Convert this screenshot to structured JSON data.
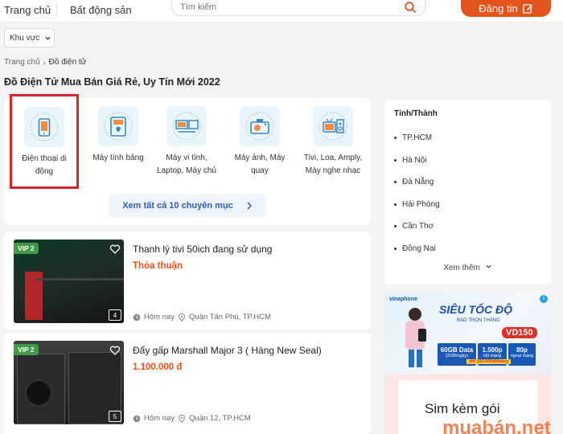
{
  "header": {
    "nav": [
      "Trang chủ",
      "Bất động sản"
    ],
    "search_placeholder": "Tìm kiếm",
    "post_button": "Đăng tin"
  },
  "filter": {
    "region_label": "Khu vực"
  },
  "breadcrumb": [
    "Trang chủ",
    "Đồ điện tử"
  ],
  "page_title": "Đồ Điện Tử Mua Bán Giá Rẻ, Uy Tín Mới 2022",
  "categories": [
    {
      "line1": "Điện thoại di",
      "line2": "động",
      "icon": "phone-icon"
    },
    {
      "line1": "Máy tính bảng",
      "line2": "",
      "icon": "tablet-icon"
    },
    {
      "line1": "Máy vi tính,",
      "line2": "Laptop, Máy chủ",
      "icon": "computer-icon"
    },
    {
      "line1": "Máy ảnh, Máy",
      "line2": "quay",
      "icon": "camera-icon"
    },
    {
      "line1": "Tivi, Loa, Amply,",
      "line2": "Máy nghe nhạc",
      "icon": "tv-icon"
    }
  ],
  "see_all_label": "Xem tất cả 10 chuyên mục",
  "listings": [
    {
      "badge": "VIP 2",
      "title": "Thanh lý tivi 50ich đang sử dụng",
      "price": "Thỏa thuận",
      "time": "Hôm nay",
      "location": "Quận Tân Phú, TP.HCM",
      "image_count": "4"
    },
    {
      "badge": "VIP 2",
      "title": "Đẩy gấp Marshall Major 3 ( Hàng New Seal)",
      "price": "1.100.000 đ",
      "time": "Hôm nay",
      "location": "Quận 12, TP.HCM",
      "image_count": "5"
    }
  ],
  "sidebar": {
    "title": "Tỉnh/Thành",
    "provinces": [
      "TP.HCM",
      "Hà Nội",
      "Đà Nẵng",
      "Hải Phòng",
      "Cần Thơ",
      "Đồng Nai"
    ],
    "see_more": "Xem thêm"
  },
  "ad": {
    "brand": "vinaphone",
    "headline": "SIÊU TỐC ĐỘ",
    "subhead": "BAO TRỌN THÁNG",
    "package": "VD150",
    "plan_data": "60GB Data",
    "plan_data_note": "(2GB/ngày)",
    "plan_call": "1.500p",
    "plan_call_note": "nội mạng",
    "plan_ext": "80p",
    "plan_ext_note": "ngoại mạng",
    "price_note": "chỉ 150.000đ/tháng",
    "sim_text": "Sim kèm gói",
    "watermark": "muabán.net",
    "choice_mark": "i"
  },
  "colors": {
    "brand_orange": "#e2541b",
    "link_blue": "#2c5bb8",
    "vip_green": "#3f9b48",
    "highlight_red": "#d9262c"
  }
}
